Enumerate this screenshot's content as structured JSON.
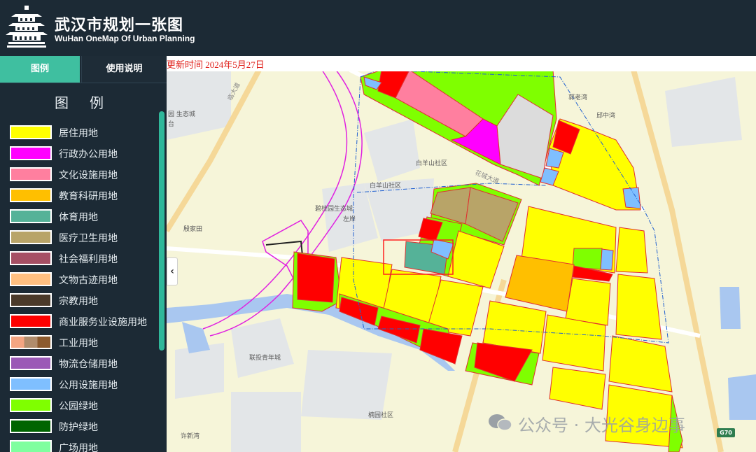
{
  "header": {
    "title_cn": "武汉市规划一张图",
    "title_en": "WuHan OneMap Of Urban Planning"
  },
  "sidebar": {
    "tabs": [
      {
        "label": "图例",
        "active": true
      },
      {
        "label": "使用说明",
        "active": false
      }
    ],
    "legend_title": "图例",
    "legend": [
      {
        "label": "居住用地",
        "color": "#ffff00"
      },
      {
        "label": "行政办公用地",
        "color": "#ff00ff"
      },
      {
        "label": "文化设施用地",
        "color": "#ff7f9f"
      },
      {
        "label": "教育科研用地",
        "color": "#ffbf00"
      },
      {
        "label": "体育用地",
        "color": "#55b298"
      },
      {
        "label": "医疗卫生用地",
        "color": "#b8a468"
      },
      {
        "label": "社会福利用地",
        "color": "#a65064"
      },
      {
        "label": "文物古迹用地",
        "color": "#ffbf80"
      },
      {
        "label": "宗教用地",
        "color": "#4b3a2a"
      },
      {
        "label": "商业服务业设施用地",
        "color": "#ff0000"
      },
      {
        "label": "工业用地",
        "colors": [
          "#f4a582",
          "#b08c6c",
          "#8c5a2e"
        ]
      },
      {
        "label": "物流仓储用地",
        "color": "#9b59b6"
      },
      {
        "label": "公用设施用地",
        "color": "#7fbfff"
      },
      {
        "label": "公园绿地",
        "color": "#7fff00"
      },
      {
        "label": "防护绿地",
        "color": "#006400"
      },
      {
        "label": "广场用地",
        "color": "#7fff9f"
      }
    ]
  },
  "map": {
    "update_text": "更新时间 2024年5月27日",
    "places": [
      {
        "name": "园 生态城"
      },
      {
        "name": "台"
      },
      {
        "name": "白羊山社区"
      },
      {
        "name": "白羊山社区"
      },
      {
        "name": "碧桂园生态城"
      },
      {
        "name": "左岸"
      },
      {
        "name": "殷家田"
      },
      {
        "name": "联投青年城"
      },
      {
        "name": "楠园社区"
      },
      {
        "name": "许新湾"
      },
      {
        "name": "郭老湾"
      },
      {
        "name": "邱中湾"
      }
    ],
    "road_labels": [
      "花城大道",
      "临大道"
    ],
    "watermark": "公众号 · 大光谷身边事",
    "highway_badge": "G70"
  }
}
